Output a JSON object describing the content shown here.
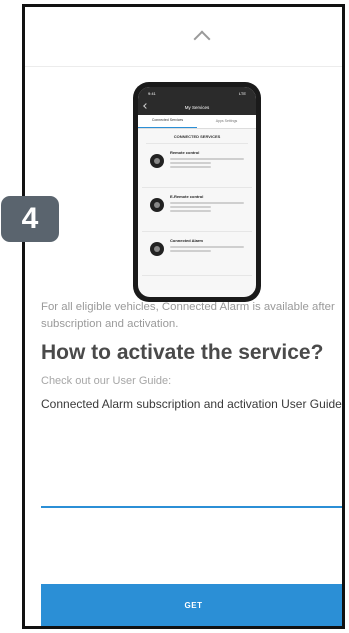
{
  "step": {
    "number": "4"
  },
  "phone": {
    "status_time": "9:41",
    "status_right": "LTE",
    "header_title": "My Services",
    "tabs": [
      {
        "label": "Connected Services",
        "active": true
      },
      {
        "label": "Apps Settings",
        "active": false
      }
    ],
    "section_title": "CONNECTED SERVICES",
    "services": [
      {
        "name": "Remote control"
      },
      {
        "name": "E-Remote control"
      },
      {
        "name": "Connected Alarm"
      }
    ]
  },
  "content": {
    "eligibility_text": "For all eligible vehicles, Connected Alarm is available after subscription and activation.",
    "heading": "How to activate the service?",
    "check_out": "Check out our User Guide:",
    "guide_link": "Connected Alarm subscription and activation User Guide"
  },
  "actions": {
    "get_label": "GET"
  },
  "colors": {
    "accent": "#2b8fd6",
    "badge": "#5a646e"
  },
  "icons": [
    "chevron-up-icon",
    "back-arrow-icon"
  ]
}
